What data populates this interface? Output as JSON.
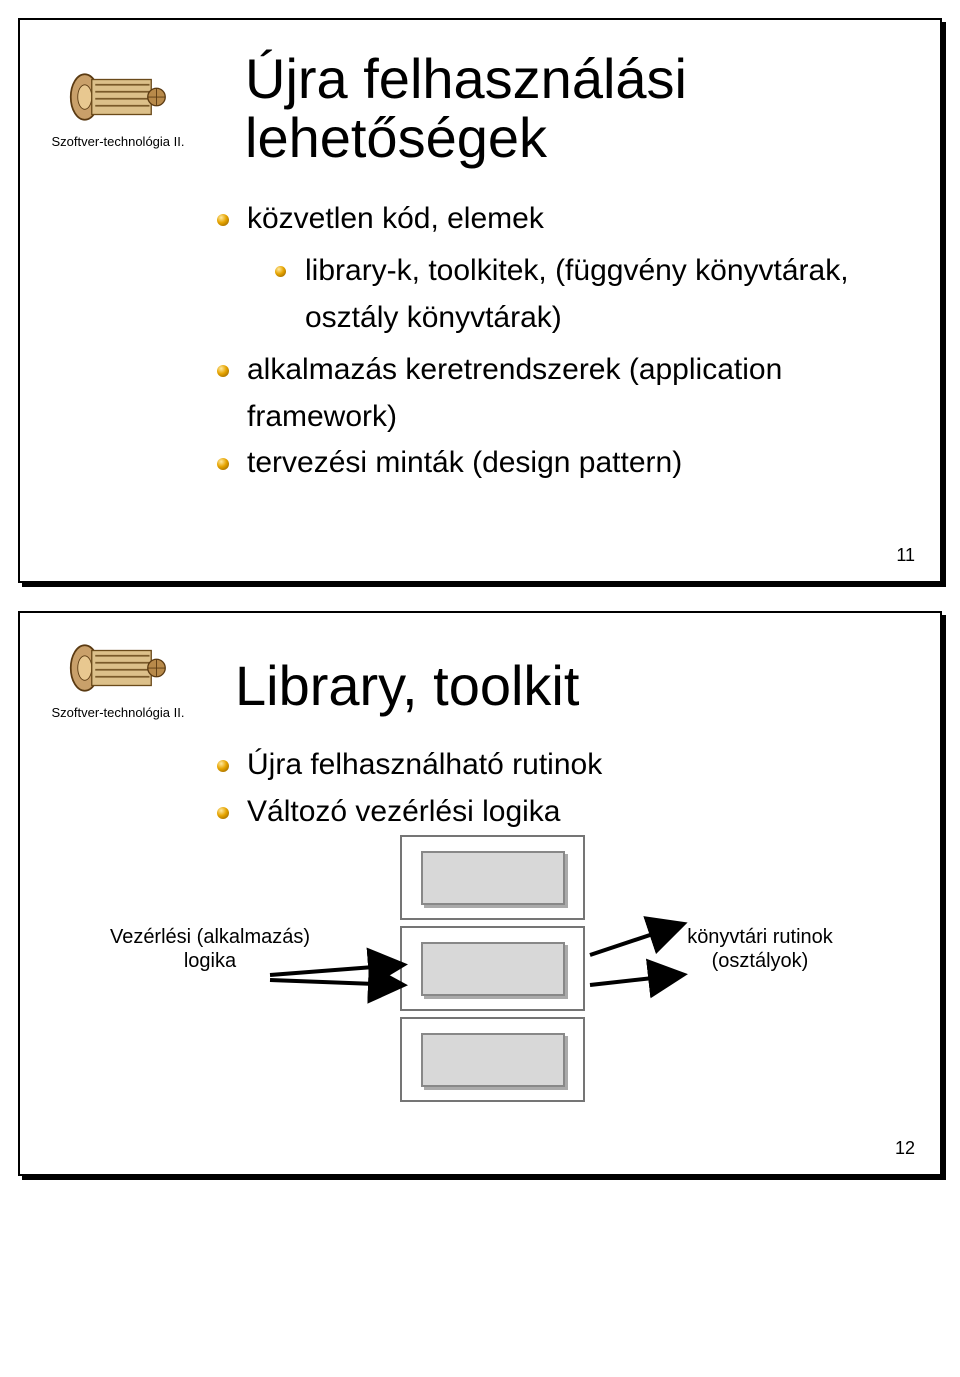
{
  "slide1": {
    "logo_caption": "Szoftver-technológia II.",
    "title": "Újra felhasználási lehetőségek",
    "bullets": {
      "b1": "közvetlen kód, elemek",
      "sub1": "library-k, toolkitek, (függvény könyvtárak, osztály könyvtárak)",
      "b2": "alkalmazás keretrendszerek (application framework)",
      "b3": "tervezési minták (design pattern)"
    },
    "page": "11"
  },
  "slide2": {
    "logo_caption": "Szoftver-technológia II.",
    "title": "Library, toolkit",
    "bullets": {
      "b1": "Újra felhasználható rutinok",
      "b2": "Változó vezérlési logika"
    },
    "left_label": "Vezérlési (alkalmazás) logika",
    "right_label": "könyvtári rutinok (osztályok)",
    "page": "12"
  }
}
